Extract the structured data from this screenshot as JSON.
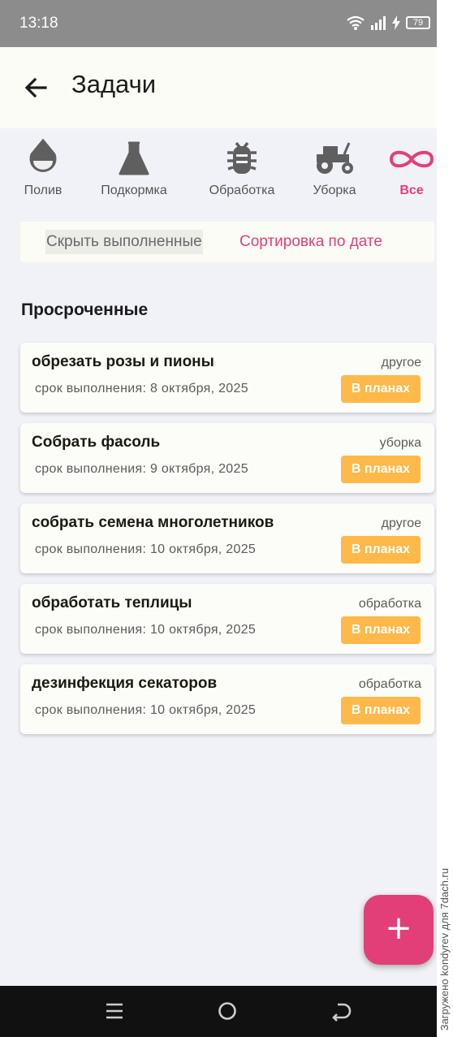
{
  "status_bar": {
    "time": "13:18",
    "battery": "79"
  },
  "appbar": {
    "title": "Задачи"
  },
  "categories": [
    {
      "label": "Полив",
      "icon": "water-drop-icon"
    },
    {
      "label": "Подкормка",
      "icon": "flask-icon"
    },
    {
      "label": "Обработка",
      "icon": "bug-icon"
    },
    {
      "label": "Уборка",
      "icon": "tractor-icon"
    },
    {
      "label": "Все",
      "icon": "infinity-icon",
      "active": true
    }
  ],
  "filters": {
    "hide_done": "Скрыть выполненные",
    "sort_by_date": "Сортировка по дате"
  },
  "section_title": "Просроченные",
  "tasks": [
    {
      "title": "обрезать розы и пионы",
      "due": "срок выполнения: 8 октября, 2025",
      "category": "другое",
      "status": "В планах"
    },
    {
      "title": "Собрать фасоль",
      "due": "срок выполнения: 9 октября, 2025",
      "category": "уборка",
      "status": "В планах"
    },
    {
      "title": "собрать семена многолетников",
      "due": "срок выполнения: 10 октября, 2025",
      "category": "другое",
      "status": "В планах"
    },
    {
      "title": "обработать теплицы",
      "due": "срок выполнения: 10 октября, 2025",
      "category": "обработка",
      "status": "В планах"
    },
    {
      "title": "дезинфекция секаторов",
      "due": "срок выполнения: 10 октября, 2025",
      "category": "обработка",
      "status": "В планах"
    }
  ],
  "fab": {
    "label": "+"
  },
  "watermark": "Загружено kondyrev для 7dach.ru",
  "colors": {
    "accent": "#e23f78",
    "status_badge": "#ffb84a",
    "background": "#f1f2f7",
    "card": "#fcfcf9"
  }
}
